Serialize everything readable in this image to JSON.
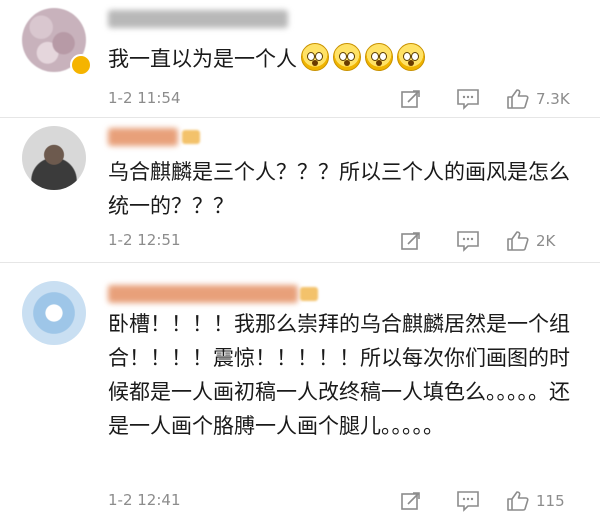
{
  "comments": [
    {
      "text": "我一直以为是一个人",
      "emoji_count": 4,
      "emoji_icon": "astonished-face-icon",
      "time": "1-2 11:54",
      "likes": "7.3K"
    },
    {
      "text": "乌合麒麟是三个人？？？所以三个人的画风是怎么统一的？？？",
      "time": "1-2 12:51",
      "likes": "2K"
    },
    {
      "text": "卧槽！！！！我那么崇拜的乌合麒麟居然是一个组合！！！！震惊！！！！！所以每次你们画图的时候都是一人画初稿一人改终稿一人填色么。。。。。还是一人画个胳膊一人画个腿儿。。。。。",
      "time": "1-2 12:41",
      "likes": "115"
    }
  ],
  "icons": {
    "share": "share-icon",
    "comment": "comment-icon",
    "like": "thumbs-up-icon"
  },
  "colors": {
    "meta_text": "#8c8c8c",
    "divider": "#e6e6e6",
    "verified_badge": "#f5b400",
    "username_orange": "#e8a07a"
  }
}
